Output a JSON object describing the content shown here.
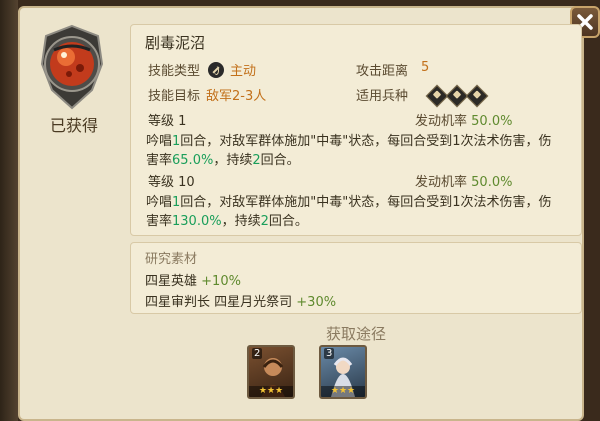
{
  "emblem": {
    "status_label": "已获得",
    "icon": "poison-bubble-icon",
    "colors": {
      "ring": "#4a4a48",
      "core": "#c23b1c",
      "highlight": "#f47a3c"
    }
  },
  "skill": {
    "name": "剧毒泥沼",
    "type_label": "技能类型",
    "type_icon": "active-skill-icon",
    "type_value": "主动",
    "range_label": "攻击距离",
    "range_value": "5",
    "target_label": "技能目标",
    "target_value": "敌军2-3人",
    "unit_label": "适用兵种",
    "unit_icons": [
      "unit-type-1-icon",
      "unit-type-2-icon",
      "unit-type-3-icon"
    ],
    "levels": [
      {
        "level_label": "等级 1",
        "rate_label": "发动机率",
        "rate_value": "50.0%",
        "desc": [
          {
            "t": "吟唱",
            "c": "dark"
          },
          {
            "t": "1",
            "c": "green"
          },
          {
            "t": "回合，对敌军群体施加\"中毒\"状态，每回合受到1次法术伤害，伤",
            "c": "dark"
          }
        ],
        "desc2": [
          {
            "t": "害率",
            "c": "dark"
          },
          {
            "t": "65.0%",
            "c": "green"
          },
          {
            "t": "，持续",
            "c": "dark"
          },
          {
            "t": "2",
            "c": "green"
          },
          {
            "t": "回合。",
            "c": "dark"
          }
        ]
      },
      {
        "level_label": "等级 10",
        "rate_label": "发动机率",
        "rate_value": "50.0%",
        "desc": [
          {
            "t": "吟唱",
            "c": "dark"
          },
          {
            "t": "1",
            "c": "green"
          },
          {
            "t": "回合，对敌军群体施加\"中毒\"状态，每回合受到1次法术伤害，伤",
            "c": "dark"
          }
        ],
        "desc2": [
          {
            "t": "害率",
            "c": "dark"
          },
          {
            "t": "130.0%",
            "c": "green"
          },
          {
            "t": "，持续",
            "c": "dark"
          },
          {
            "t": "2",
            "c": "green"
          },
          {
            "t": "回合。",
            "c": "dark"
          }
        ]
      }
    ]
  },
  "materials": {
    "title": "研究素材",
    "rows": [
      {
        "name": "四星英雄",
        "bonus": "+10%"
      },
      {
        "name": "四星审判长 四星月光祭司",
        "bonus": "+30%"
      }
    ]
  },
  "acquire": {
    "title": "获取途径",
    "heroes": [
      {
        "name": "hero-warrior",
        "badge": "2",
        "stars": "★★★",
        "color": "#5a3a22"
      },
      {
        "name": "hero-priestess",
        "badge": "3",
        "stars": "★★★",
        "color": "#3a4a5a"
      }
    ]
  },
  "colors": {
    "panel": "#ece4cc",
    "accent_gold": "#c2701a",
    "value_green": "#1a9e5a",
    "bonus_olive": "#5f8a2e",
    "close_bg": "#5e4430"
  }
}
